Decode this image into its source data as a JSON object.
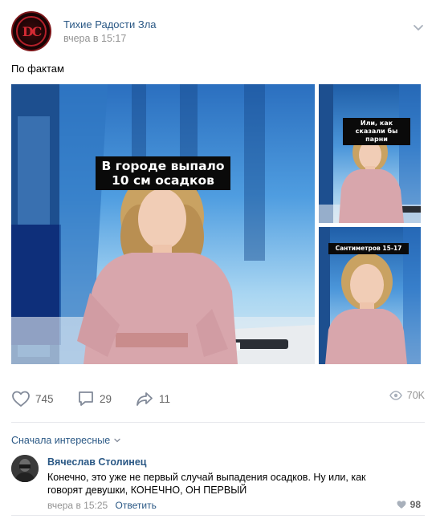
{
  "post": {
    "group_name": "Тихие Радости Зла",
    "time": "вчера в 15:17",
    "text": "По фактам",
    "avatar_letters": "DC",
    "menu_icon": "chevron-down-icon"
  },
  "media": {
    "main_caption_line1": "В городе выпало",
    "main_caption_line2": "10 см осадков",
    "side1_caption_line1": "Или, как",
    "side1_caption_line2": "сказали бы парни",
    "side2_caption": "Сантиметров 15-17"
  },
  "actions": {
    "likes": "745",
    "comments": "29",
    "shares": "11",
    "views": "70K"
  },
  "comments_sort": {
    "label": "Сначала интересные"
  },
  "comment": {
    "author": "Вячеслав Столинец",
    "text": "Конечно, это уже не первый случай выпадения осадков. Ну или, как говорят девушки, КОНЕЧНО, ОН ПЕРВЫЙ",
    "time": "вчера в 15:25",
    "reply_label": "Ответить",
    "likes": "98"
  },
  "colors": {
    "link": "#2a5885",
    "muted": "#939393",
    "icon": "#828a99"
  }
}
